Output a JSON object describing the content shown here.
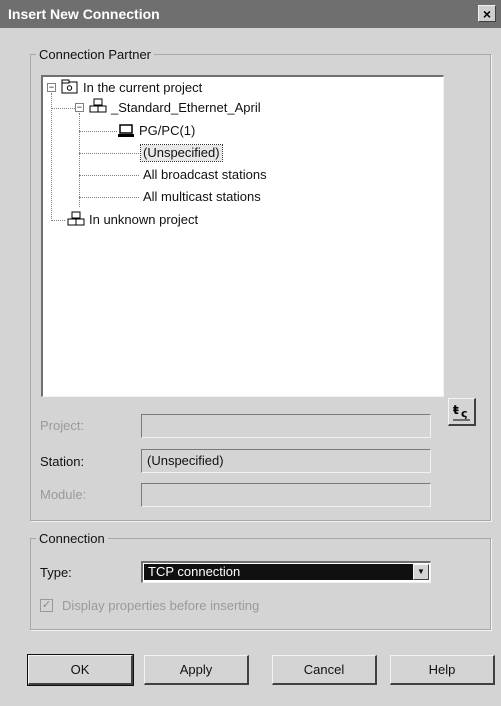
{
  "dialog": {
    "title": "Insert New Connection",
    "close_glyph": "×"
  },
  "partner": {
    "group_label": "Connection Partner",
    "tree": {
      "current_project": "In the current project",
      "project_name": "_Standard_Ethernet_April",
      "pgpc": "PG/PC(1)",
      "unspecified": "(Unspecified)",
      "broadcast": "All broadcast stations",
      "multicast": "All multicast stations",
      "unknown_project": "In unknown project"
    },
    "project_label": "Project:",
    "project_value": "",
    "station_label": "Station:",
    "station_value": "(Unspecified)",
    "module_label": "Module:",
    "module_value": ""
  },
  "connection": {
    "group_label": "Connection",
    "type_label": "Type:",
    "type_value": "TCP connection",
    "display_checkbox_label": "Display properties before inserting",
    "display_checked": true
  },
  "buttons": {
    "ok": "OK",
    "apply": "Apply",
    "cancel": "Cancel",
    "help": "Help"
  }
}
